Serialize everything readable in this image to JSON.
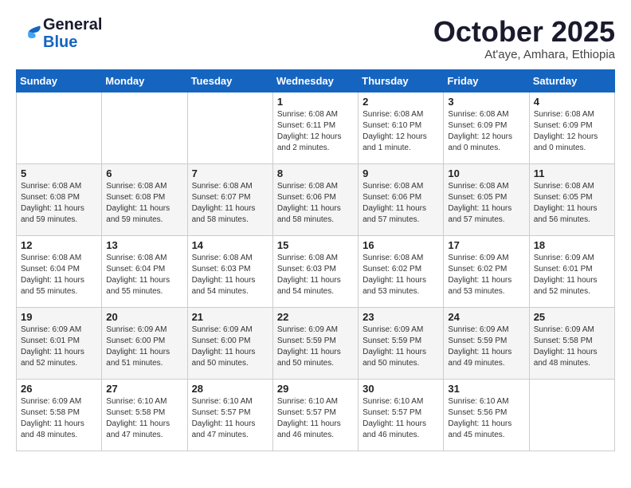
{
  "header": {
    "logo_general": "General",
    "logo_blue": "Blue",
    "month": "October 2025",
    "location": "At'aye, Amhara, Ethiopia"
  },
  "weekdays": [
    "Sunday",
    "Monday",
    "Tuesday",
    "Wednesday",
    "Thursday",
    "Friday",
    "Saturday"
  ],
  "weeks": [
    [
      {
        "day": "",
        "info": ""
      },
      {
        "day": "",
        "info": ""
      },
      {
        "day": "",
        "info": ""
      },
      {
        "day": "1",
        "info": "Sunrise: 6:08 AM\nSunset: 6:11 PM\nDaylight: 12 hours\nand 2 minutes."
      },
      {
        "day": "2",
        "info": "Sunrise: 6:08 AM\nSunset: 6:10 PM\nDaylight: 12 hours\nand 1 minute."
      },
      {
        "day": "3",
        "info": "Sunrise: 6:08 AM\nSunset: 6:09 PM\nDaylight: 12 hours\nand 0 minutes."
      },
      {
        "day": "4",
        "info": "Sunrise: 6:08 AM\nSunset: 6:09 PM\nDaylight: 12 hours\nand 0 minutes."
      }
    ],
    [
      {
        "day": "5",
        "info": "Sunrise: 6:08 AM\nSunset: 6:08 PM\nDaylight: 11 hours\nand 59 minutes."
      },
      {
        "day": "6",
        "info": "Sunrise: 6:08 AM\nSunset: 6:08 PM\nDaylight: 11 hours\nand 59 minutes."
      },
      {
        "day": "7",
        "info": "Sunrise: 6:08 AM\nSunset: 6:07 PM\nDaylight: 11 hours\nand 58 minutes."
      },
      {
        "day": "8",
        "info": "Sunrise: 6:08 AM\nSunset: 6:06 PM\nDaylight: 11 hours\nand 58 minutes."
      },
      {
        "day": "9",
        "info": "Sunrise: 6:08 AM\nSunset: 6:06 PM\nDaylight: 11 hours\nand 57 minutes."
      },
      {
        "day": "10",
        "info": "Sunrise: 6:08 AM\nSunset: 6:05 PM\nDaylight: 11 hours\nand 57 minutes."
      },
      {
        "day": "11",
        "info": "Sunrise: 6:08 AM\nSunset: 6:05 PM\nDaylight: 11 hours\nand 56 minutes."
      }
    ],
    [
      {
        "day": "12",
        "info": "Sunrise: 6:08 AM\nSunset: 6:04 PM\nDaylight: 11 hours\nand 55 minutes."
      },
      {
        "day": "13",
        "info": "Sunrise: 6:08 AM\nSunset: 6:04 PM\nDaylight: 11 hours\nand 55 minutes."
      },
      {
        "day": "14",
        "info": "Sunrise: 6:08 AM\nSunset: 6:03 PM\nDaylight: 11 hours\nand 54 minutes."
      },
      {
        "day": "15",
        "info": "Sunrise: 6:08 AM\nSunset: 6:03 PM\nDaylight: 11 hours\nand 54 minutes."
      },
      {
        "day": "16",
        "info": "Sunrise: 6:08 AM\nSunset: 6:02 PM\nDaylight: 11 hours\nand 53 minutes."
      },
      {
        "day": "17",
        "info": "Sunrise: 6:09 AM\nSunset: 6:02 PM\nDaylight: 11 hours\nand 53 minutes."
      },
      {
        "day": "18",
        "info": "Sunrise: 6:09 AM\nSunset: 6:01 PM\nDaylight: 11 hours\nand 52 minutes."
      }
    ],
    [
      {
        "day": "19",
        "info": "Sunrise: 6:09 AM\nSunset: 6:01 PM\nDaylight: 11 hours\nand 52 minutes."
      },
      {
        "day": "20",
        "info": "Sunrise: 6:09 AM\nSunset: 6:00 PM\nDaylight: 11 hours\nand 51 minutes."
      },
      {
        "day": "21",
        "info": "Sunrise: 6:09 AM\nSunset: 6:00 PM\nDaylight: 11 hours\nand 50 minutes."
      },
      {
        "day": "22",
        "info": "Sunrise: 6:09 AM\nSunset: 5:59 PM\nDaylight: 11 hours\nand 50 minutes."
      },
      {
        "day": "23",
        "info": "Sunrise: 6:09 AM\nSunset: 5:59 PM\nDaylight: 11 hours\nand 50 minutes."
      },
      {
        "day": "24",
        "info": "Sunrise: 6:09 AM\nSunset: 5:59 PM\nDaylight: 11 hours\nand 49 minutes."
      },
      {
        "day": "25",
        "info": "Sunrise: 6:09 AM\nSunset: 5:58 PM\nDaylight: 11 hours\nand 48 minutes."
      }
    ],
    [
      {
        "day": "26",
        "info": "Sunrise: 6:09 AM\nSunset: 5:58 PM\nDaylight: 11 hours\nand 48 minutes."
      },
      {
        "day": "27",
        "info": "Sunrise: 6:10 AM\nSunset: 5:58 PM\nDaylight: 11 hours\nand 47 minutes."
      },
      {
        "day": "28",
        "info": "Sunrise: 6:10 AM\nSunset: 5:57 PM\nDaylight: 11 hours\nand 47 minutes."
      },
      {
        "day": "29",
        "info": "Sunrise: 6:10 AM\nSunset: 5:57 PM\nDaylight: 11 hours\nand 46 minutes."
      },
      {
        "day": "30",
        "info": "Sunrise: 6:10 AM\nSunset: 5:57 PM\nDaylight: 11 hours\nand 46 minutes."
      },
      {
        "day": "31",
        "info": "Sunrise: 6:10 AM\nSunset: 5:56 PM\nDaylight: 11 hours\nand 45 minutes."
      },
      {
        "day": "",
        "info": ""
      }
    ]
  ]
}
